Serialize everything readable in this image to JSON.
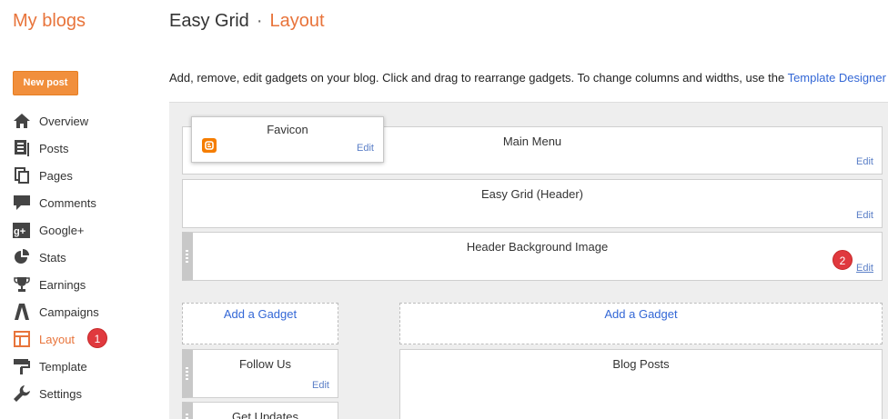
{
  "brand": "My blogs",
  "breadcrumb": {
    "blog": "Easy Grid",
    "separator": "·",
    "section": "Layout"
  },
  "new_post": "New post",
  "nav": [
    {
      "label": "Overview",
      "icon": "home-icon"
    },
    {
      "label": "Posts",
      "icon": "posts-icon"
    },
    {
      "label": "Pages",
      "icon": "pages-icon"
    },
    {
      "label": "Comments",
      "icon": "comments-icon"
    },
    {
      "label": "Google+",
      "icon": "google-plus-icon"
    },
    {
      "label": "Stats",
      "icon": "stats-icon"
    },
    {
      "label": "Earnings",
      "icon": "trophy-icon"
    },
    {
      "label": "Campaigns",
      "icon": "campaigns-icon"
    },
    {
      "label": "Layout",
      "icon": "layout-icon",
      "active": true
    },
    {
      "label": "Template",
      "icon": "template-icon"
    },
    {
      "label": "Settings",
      "icon": "wrench-icon"
    }
  ],
  "description": {
    "text": "Add, remove, edit gadgets on your blog. Click and drag to rearrange gadgets. To change columns and widths, use the ",
    "link": "Template Designer"
  },
  "gadgets": {
    "favicon": {
      "title": "Favicon",
      "edit": "Edit"
    },
    "main_menu": {
      "title": "Main Menu",
      "edit": "Edit"
    },
    "header": {
      "title": "Easy Grid (Header)",
      "edit": "Edit"
    },
    "header_bg": {
      "title": "Header Background Image",
      "edit": "Edit"
    },
    "add_left": "Add a Gadget",
    "add_right": "Add a Gadget",
    "follow_us": {
      "title": "Follow Us",
      "edit": "Edit"
    },
    "get_updates": {
      "title": "Get Updates"
    },
    "blog_posts": {
      "title": "Blog Posts"
    }
  },
  "badges": {
    "layout": "1",
    "edit": "2"
  },
  "colors": {
    "accent": "#e8743b",
    "button": "#f18f3c",
    "link": "#3367d6",
    "badge": "#e0393e"
  }
}
